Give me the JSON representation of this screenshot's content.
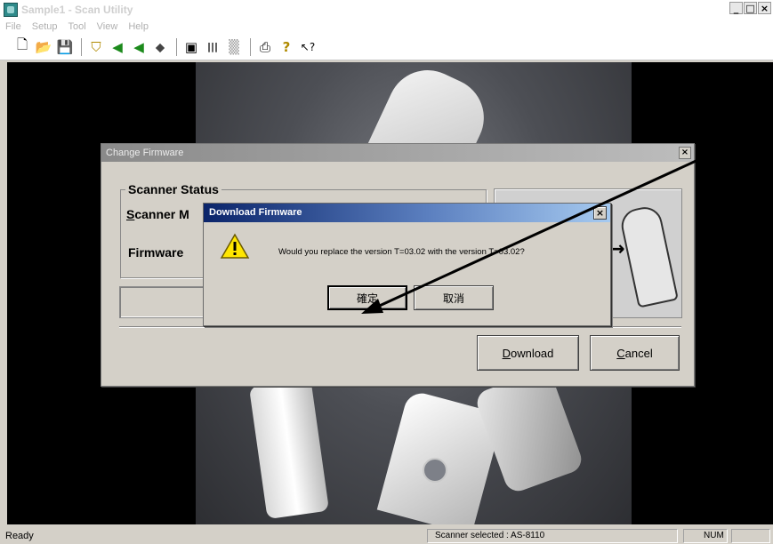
{
  "window": {
    "title": "Sample1 - Scan Utility",
    "minimize": "_",
    "maximize": "□",
    "close": "×"
  },
  "menu": [
    "File",
    "Setup",
    "Tool",
    "View",
    "Help"
  ],
  "toolbar": {
    "icons": [
      "new-file-icon",
      "open-folder-icon",
      "save-icon",
      "scanner-icon",
      "send-icon",
      "receive-icon",
      "tag-icon",
      "picture-icon",
      "barcode-icon",
      "pattern-icon",
      "print-icon",
      "help-icon",
      "context-help-icon"
    ],
    "glyphs": [
      "🗋",
      "📂",
      "💾",
      "⛉",
      "◀",
      "◀",
      "⬥",
      "▣",
      "|||",
      "▒",
      "⎙",
      "?",
      "↖?"
    ]
  },
  "change_firmware": {
    "title": "Change Firmware",
    "close": "×",
    "group_label": "Scanner Status",
    "scanner_label": "Scanner M",
    "firmware_label": "Firmware",
    "download_button": {
      "mnemonic": "D",
      "rest": "ownload"
    },
    "cancel_button": {
      "mnemonic": "C",
      "rest": "ancel"
    }
  },
  "download_dialog": {
    "title": "Download Firmware",
    "close": "×",
    "message": "Would you replace the version T=03.02 with the version T=03.02?",
    "ok_button": "確定",
    "cancel_button": "取消"
  },
  "statusbar": {
    "ready": "Ready",
    "scanner_selected": "Scanner selected : AS-8110",
    "num": "NUM"
  },
  "colors": {
    "dialog_face": "#d4d0c8",
    "active_title_start": "#0a246a",
    "active_title_end": "#a6caf0",
    "warning_yellow": "#ffe600"
  }
}
